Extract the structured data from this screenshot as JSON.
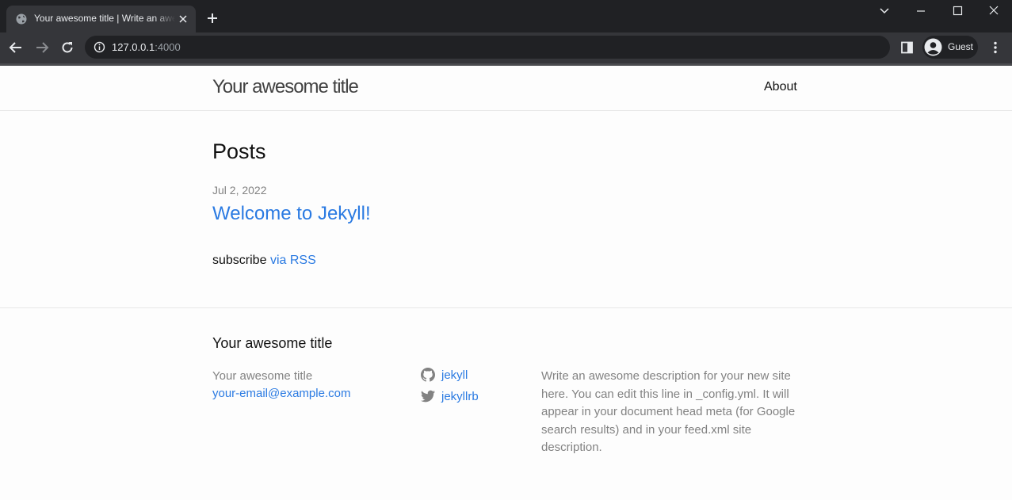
{
  "browser": {
    "tab_title": "Your awesome title | Write an awesome description for your new site here.",
    "url_host": "127.0.0.1",
    "url_port": ":4000",
    "profile_label": "Guest"
  },
  "header": {
    "site_title": "Your awesome title",
    "nav": [
      {
        "label": "About"
      }
    ]
  },
  "main": {
    "heading": "Posts",
    "posts": [
      {
        "date": "Jul 2, 2022",
        "title": "Welcome to Jekyll!"
      }
    ],
    "rss_prefix": "subscribe",
    "rss_link": "via RSS"
  },
  "footer": {
    "heading": "Your awesome title",
    "name": "Your awesome title",
    "email": "your-email@example.com",
    "social": [
      {
        "icon": "github-icon",
        "label": "jekyll"
      },
      {
        "icon": "twitter-icon",
        "label": "jekyllrb"
      }
    ],
    "description": "Write an awesome description for your new site here. You can edit this line in _config.yml. It will appear in your document head meta (for Google search results) and in your feed.xml site description."
  },
  "colors": {
    "link": "#2a7ae2",
    "muted": "#828282",
    "chrome_dark": "#202124",
    "chrome_toolbar": "#35363a"
  }
}
